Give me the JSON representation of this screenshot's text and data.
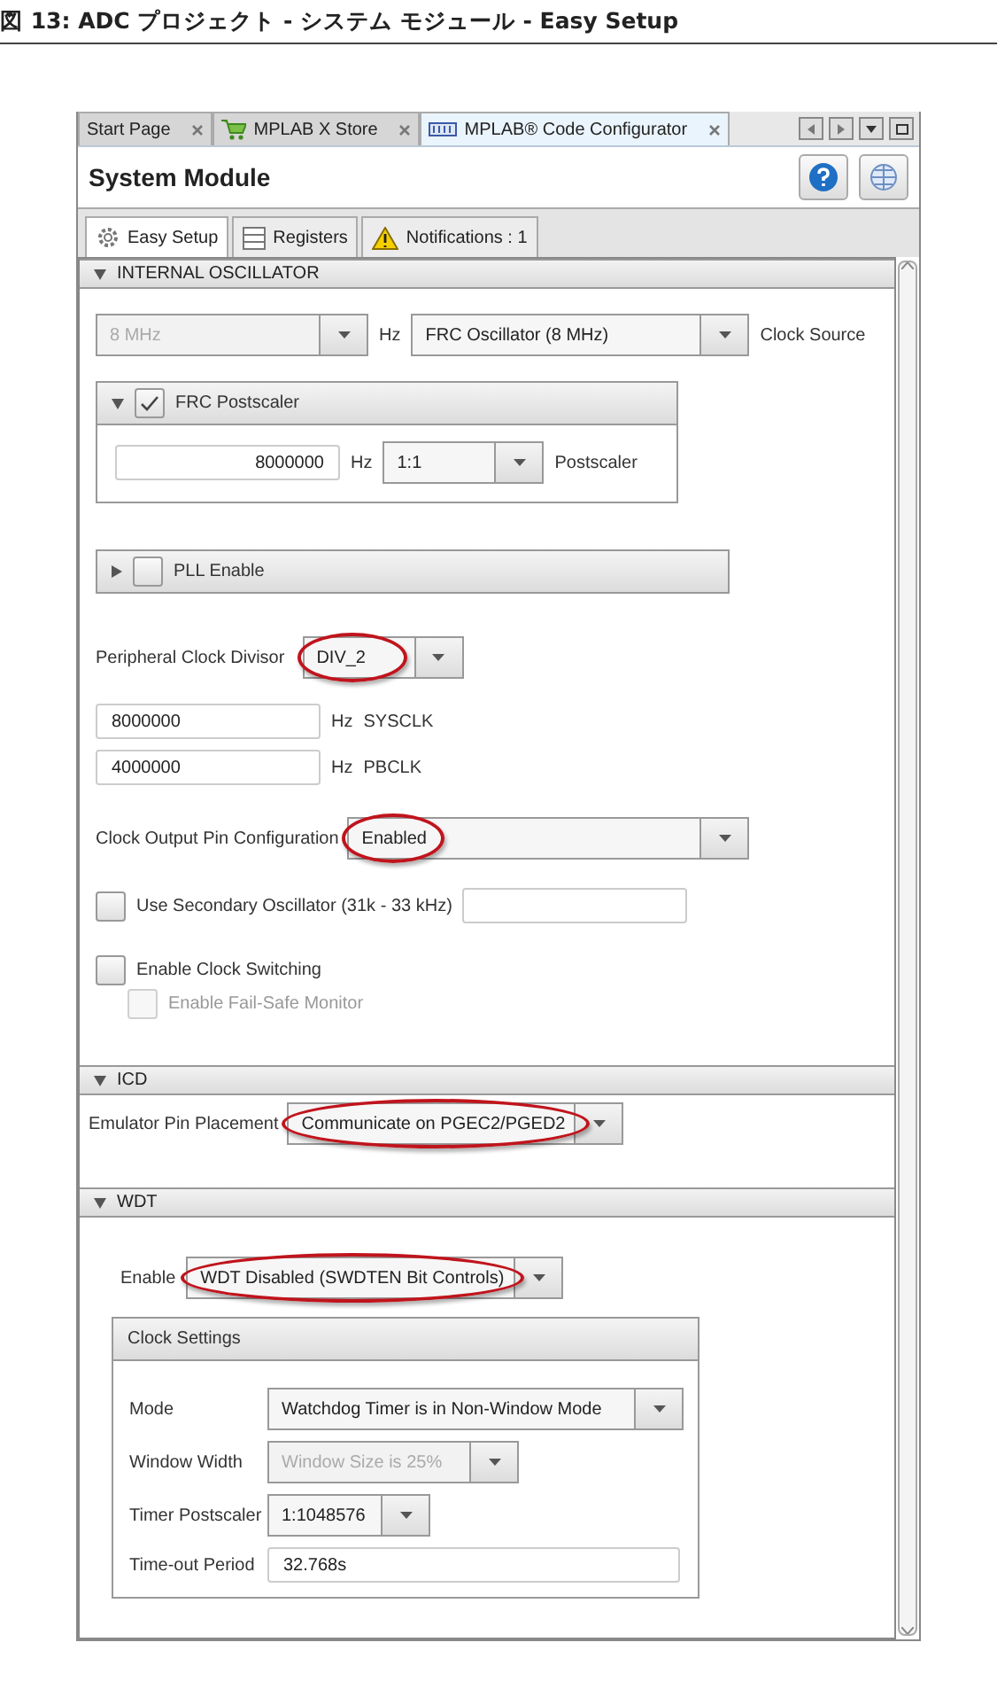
{
  "caption": "図 13:  ADC プロジェクト - システム モジュール - Easy Setup",
  "editor_tabs": [
    {
      "label": "Start Page",
      "kind": "page",
      "selected": false
    },
    {
      "label": "MPLAB X Store",
      "kind": "store",
      "selected": false
    },
    {
      "label": "MPLAB® Code Configurator",
      "kind": "mcc",
      "selected": true
    }
  ],
  "module_title": "System Module",
  "view_tabs": [
    {
      "label": "Easy Setup",
      "kind": "gear",
      "selected": true
    },
    {
      "label": "Registers",
      "kind": "registers",
      "selected": false
    },
    {
      "label": "Notifications : 1",
      "kind": "warning",
      "selected": false
    }
  ],
  "internal_oscillator": {
    "header": "INTERNAL OSCILLATOR",
    "expanded": true,
    "frequency": {
      "value": "8 MHz",
      "disabled": true
    },
    "frequency_unit": "Hz",
    "clock_source": {
      "value": "FRC Oscillator (8 MHz)",
      "disabled": false
    },
    "clock_source_label": "Clock Source",
    "frc_postscaler": {
      "label": "FRC Postscaler",
      "expanded": true,
      "checked": true,
      "frequency": "8000000",
      "unit": "Hz",
      "postscaler": "1:1",
      "postscaler_label": "Postscaler"
    },
    "pll": {
      "label": "PLL Enable",
      "expanded": false,
      "checked": false
    },
    "peripheral_clock_divisor": {
      "label": "Peripheral Clock Divisor",
      "value": "DIV_2",
      "highlighted": true
    },
    "clocks": [
      {
        "value": "8000000",
        "unit": "Hz",
        "name": "SYSCLK"
      },
      {
        "value": "4000000",
        "unit": "Hz",
        "name": "PBCLK"
      }
    ],
    "clock_output": {
      "label": "Clock Output Pin Configuration",
      "value": "Enabled",
      "highlighted": true
    },
    "options": [
      {
        "label": "Use Secondary Oscillator (31k - 33 kHz)",
        "kind": "with_field",
        "checked": false,
        "disabled": false
      },
      {
        "label": "Enable Clock Switching",
        "kind": "plain",
        "checked": false,
        "disabled": false
      },
      {
        "label": "Enable Fail-Safe Monitor",
        "kind": "sub",
        "checked": false,
        "disabled": true
      }
    ]
  },
  "icd": {
    "header": "ICD",
    "expanded": true,
    "emulator_pin": {
      "label": "Emulator Pin Placement",
      "value": "Communicate on PGEC2/PGED2",
      "highlighted": true
    }
  },
  "wdt": {
    "header": "WDT",
    "expanded": true,
    "enable": {
      "label": "Enable",
      "value": "WDT Disabled (SWDTEN Bit Controls)",
      "highlighted": true
    },
    "clock_settings": {
      "header": "Clock Settings",
      "rows": [
        {
          "label": "Mode",
          "kind": "combo",
          "value": "Watchdog Timer is in Non-Window Mode",
          "disabled": false
        },
        {
          "label": "Window Width",
          "kind": "combo",
          "value": "Window Size is 25%",
          "disabled": true
        },
        {
          "label": "Timer Postscaler",
          "kind": "combo",
          "value": "1:1048576",
          "disabled": false
        },
        {
          "label": "Time-out Period",
          "kind": "field",
          "value": "32.768s",
          "disabled": false
        }
      ]
    }
  }
}
